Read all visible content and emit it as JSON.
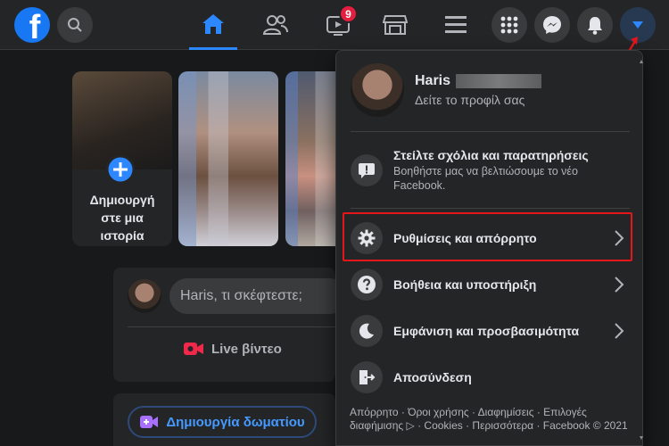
{
  "topbar": {
    "logo_letter": "f",
    "notification_count": "9"
  },
  "stories": {
    "create_label_line1": "Δημιουργή",
    "create_label_line2": "στε μια",
    "create_label_line3": "ιστορία"
  },
  "composer": {
    "placeholder": "Haris, τι σκέφτεστε;",
    "live_label": "Live βίντεο",
    "room_label": "Δημιουργία δωματίου"
  },
  "menu": {
    "profile_name": "Haris",
    "profile_sub": "Δείτε το προφίλ σας",
    "feedback_title": "Στείλτε σχόλια και παρατηρήσεις",
    "feedback_sub": "Βοηθήστε μας να βελτιώσουμε το νέο Facebook.",
    "settings_label": "Ρυθμίσεις και απόρρητο",
    "help_label": "Βοήθεια και υποστήριξη",
    "display_label": "Εμφάνιση και προσβασιμότητα",
    "logout_label": "Αποσύνδεση",
    "footer_text": "Απόρρητο · Όροι χρήσης · Διαφημίσεις · Επιλογές διαφήμισης ▷ · Cookies · Περισσότερα · Facebook © 2021"
  },
  "colors": {
    "accent": "#2d88ff",
    "highlight_box": "#e4161b",
    "badge": "#e41e3f"
  }
}
